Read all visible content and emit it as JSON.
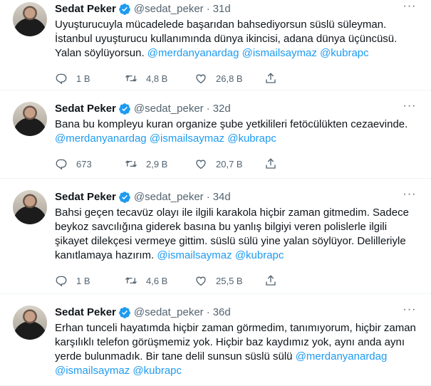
{
  "tweets": [
    {
      "name": "Sedat Peker",
      "handle": "@sedat_peker",
      "dot": "·",
      "time": "31d",
      "lines": [
        [
          {
            "t": "Uyuşturucuyla mücadelede başarıdan bahsediyorsun süslü süleyman."
          }
        ],
        [
          {
            "t": "İstanbul uyuşturucu kullanımında dünya ikincisi, adana dünya üçüncüsü."
          }
        ],
        [
          {
            "t": "Yalan söylüyorsun. "
          },
          {
            "t": "@merdanyanardag",
            "m": true
          },
          {
            "t": " "
          },
          {
            "t": "@ismailsaymaz",
            "m": true
          },
          {
            "t": " "
          },
          {
            "t": "@kubrapc",
            "m": true
          }
        ]
      ],
      "replies": "1 B",
      "retweets": "4,8 B",
      "likes": "26,8 B"
    },
    {
      "name": "Sedat Peker",
      "handle": "@sedat_peker",
      "dot": "·",
      "time": "32d",
      "lines": [
        [
          {
            "t": "Bana bu kompleyu kuran organize şube yetkilileri fetöcülükten cezaevinde."
          }
        ],
        [
          {
            "t": "@merdanyanardag",
            "m": true
          },
          {
            "t": " "
          },
          {
            "t": "@ismailsaymaz",
            "m": true
          },
          {
            "t": " "
          },
          {
            "t": "@kubrapc",
            "m": true
          }
        ]
      ],
      "replies": "673",
      "retweets": "2,9 B",
      "likes": "20,7 B"
    },
    {
      "name": "Sedat Peker",
      "handle": "@sedat_peker",
      "dot": "·",
      "time": "34d",
      "lines": [
        [
          {
            "t": "Bahsi geçen tecavüz olayı ile ilgili karakola hiçbir zaman gitmedim. Sadece"
          }
        ],
        [
          {
            "t": "beykoz savcılığına giderek basına bu yanlış bilgiyi veren polislerle ilgili"
          }
        ],
        [
          {
            "t": "şikayet dilekçesi vermeye gittim. süslü sülü yine yalan söylüyor. Delilleriyle"
          }
        ],
        [
          {
            "t": "kanıtlamaya hazırım. "
          },
          {
            "t": "@ismailsaymaz",
            "m": true
          },
          {
            "t": "  "
          },
          {
            "t": "@kubrapc",
            "m": true
          }
        ]
      ],
      "replies": "1 B",
      "retweets": "4,6 B",
      "likes": "25,5 B"
    },
    {
      "name": "Sedat Peker",
      "handle": "@sedat_peker",
      "dot": "·",
      "time": "36d",
      "lines": [
        [
          {
            "t": "Erhan tunceli hayatımda hiçbir zaman görmedim, tanımıyorum, hiçbir zaman"
          }
        ],
        [
          {
            "t": "karşılıklı telefon görüşmemiz yok. Hiçbir baz kaydımız yok, aynı anda aynı"
          }
        ],
        [
          {
            "t": "yerde bulunmadık. Bir tane delil sunsun süslü sülü "
          },
          {
            "t": "@merdanyanardag",
            "m": true
          }
        ],
        [
          {
            "t": "@ismailsaymaz",
            "m": true
          },
          {
            "t": " "
          },
          {
            "t": "@kubrapc",
            "m": true
          }
        ]
      ],
      "replies": "",
      "retweets": "",
      "likes": ""
    }
  ],
  "colors": {
    "accent": "#1d9bf0",
    "muted": "#536471",
    "text": "#0f1419",
    "divider": "#eff3f4"
  },
  "icons": [
    "verified-badge-icon",
    "more-icon",
    "reply-icon",
    "retweet-icon",
    "like-icon",
    "share-icon"
  ]
}
